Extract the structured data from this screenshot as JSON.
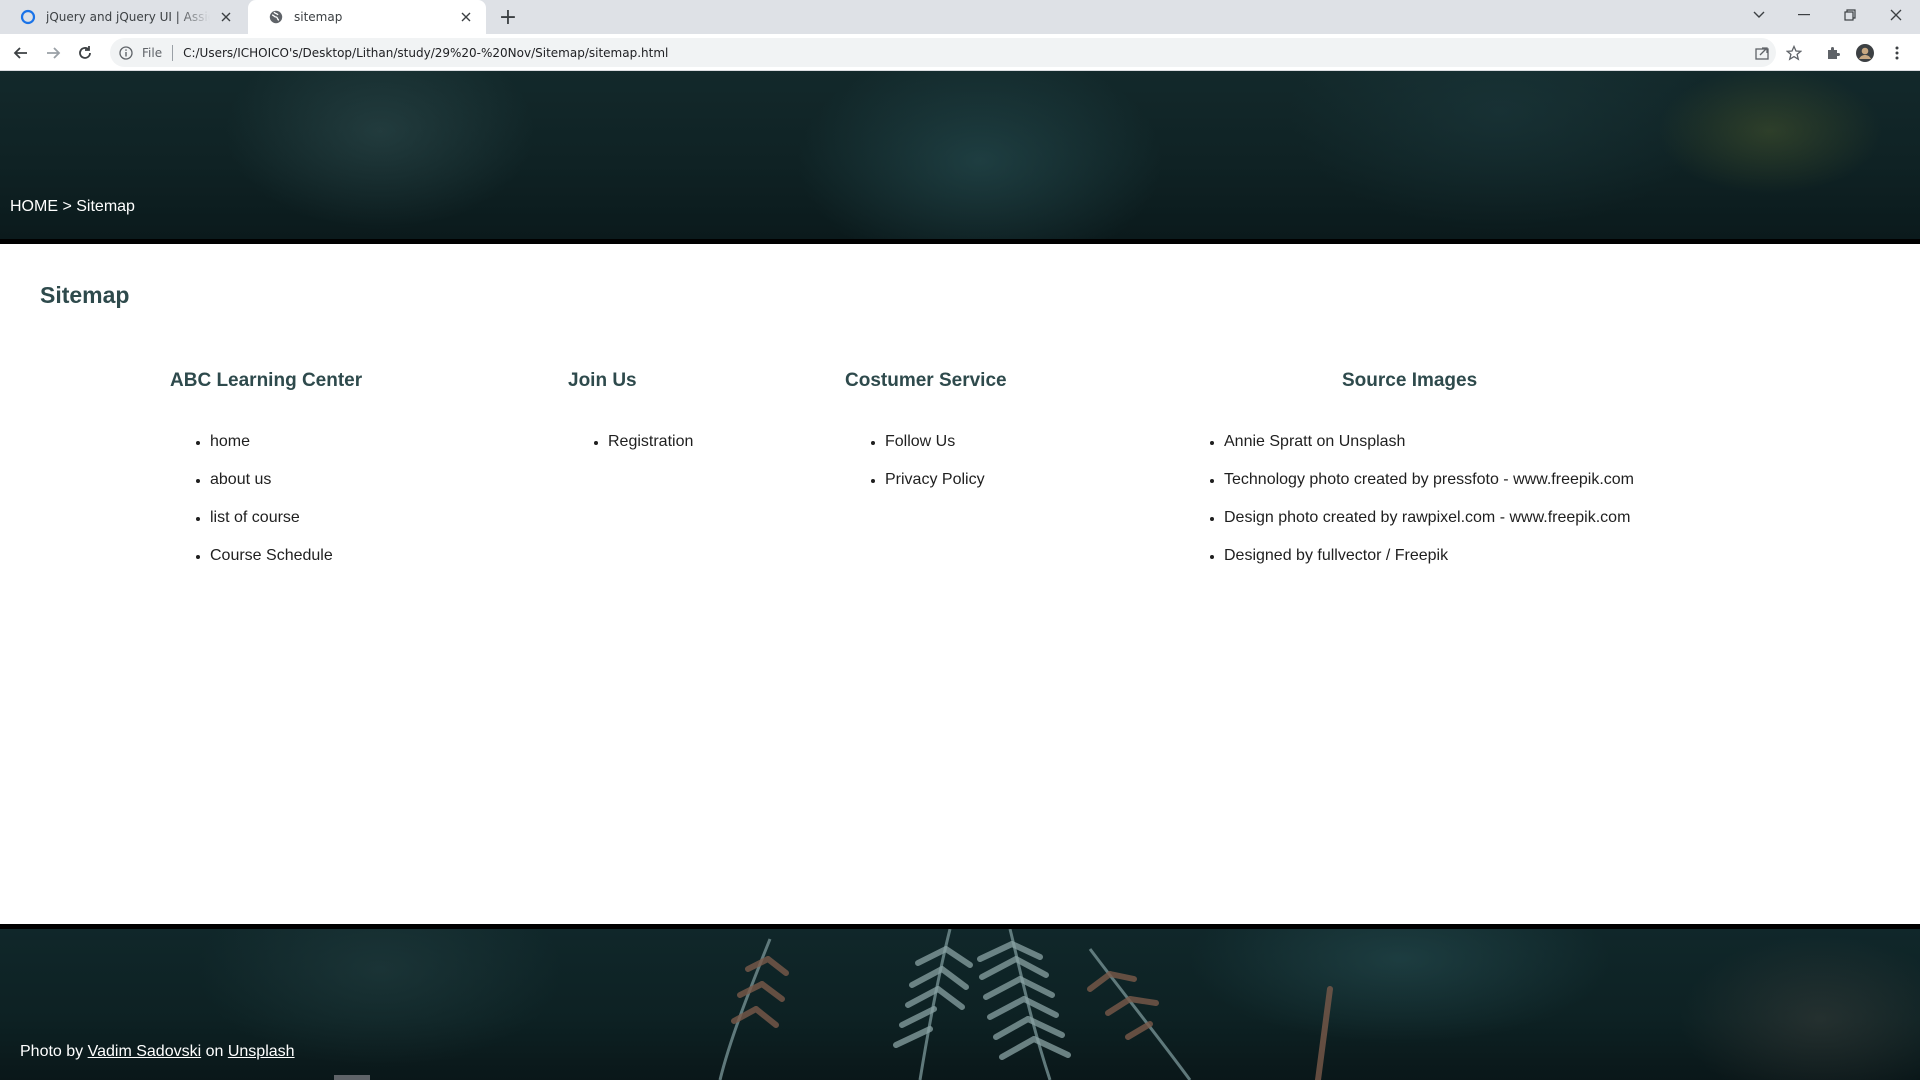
{
  "browser": {
    "tabs": [
      {
        "title": "jQuery and jQuery UI | Assignment",
        "active": false
      },
      {
        "title": "sitemap",
        "active": true
      }
    ],
    "omnibox": {
      "scheme_label": "File",
      "url": "C:/Users/ICHOICO's/Desktop/Lithan/study/29%20-%20Nov/Sitemap/sitemap.html"
    }
  },
  "page": {
    "breadcrumb": {
      "home": "HOME",
      "separator": ">",
      "current": "Sitemap"
    },
    "title": "Sitemap",
    "columns": [
      {
        "heading": "ABC Learning Center",
        "items": [
          "home",
          "about us",
          "list of course",
          "Course Schedule"
        ]
      },
      {
        "heading": "Join Us",
        "items": [
          "Registration"
        ]
      },
      {
        "heading": "Costumer Service",
        "items": [
          "Follow Us",
          "Privacy Policy"
        ]
      },
      {
        "heading": "Source Images",
        "items": [
          "Annie Spratt on Unsplash",
          "Technology photo created by pressfoto - www.freepik.com",
          "Design photo created by rawpixel.com - www.freepik.com",
          "Designed by fullvector / Freepik"
        ]
      }
    ],
    "footer": {
      "prefix": "Photo by",
      "author": "Vadim Sadovski",
      "middle": "on",
      "site": "Unsplash"
    }
  },
  "colors": {
    "heading": "#2e4a4c",
    "hero_dark": "#0f2224",
    "tabstrip": "#dee1e6"
  },
  "icons": [
    "tab-favicon-icon",
    "globe-icon",
    "close-icon",
    "plus-icon",
    "chevron-down-icon",
    "minimize-icon",
    "restore-icon",
    "window-close-icon",
    "back-arrow-icon",
    "forward-arrow-icon",
    "reload-icon",
    "info-icon",
    "share-icon",
    "star-icon",
    "puzzle-icon",
    "profile-icon",
    "kebab-menu-icon"
  ]
}
